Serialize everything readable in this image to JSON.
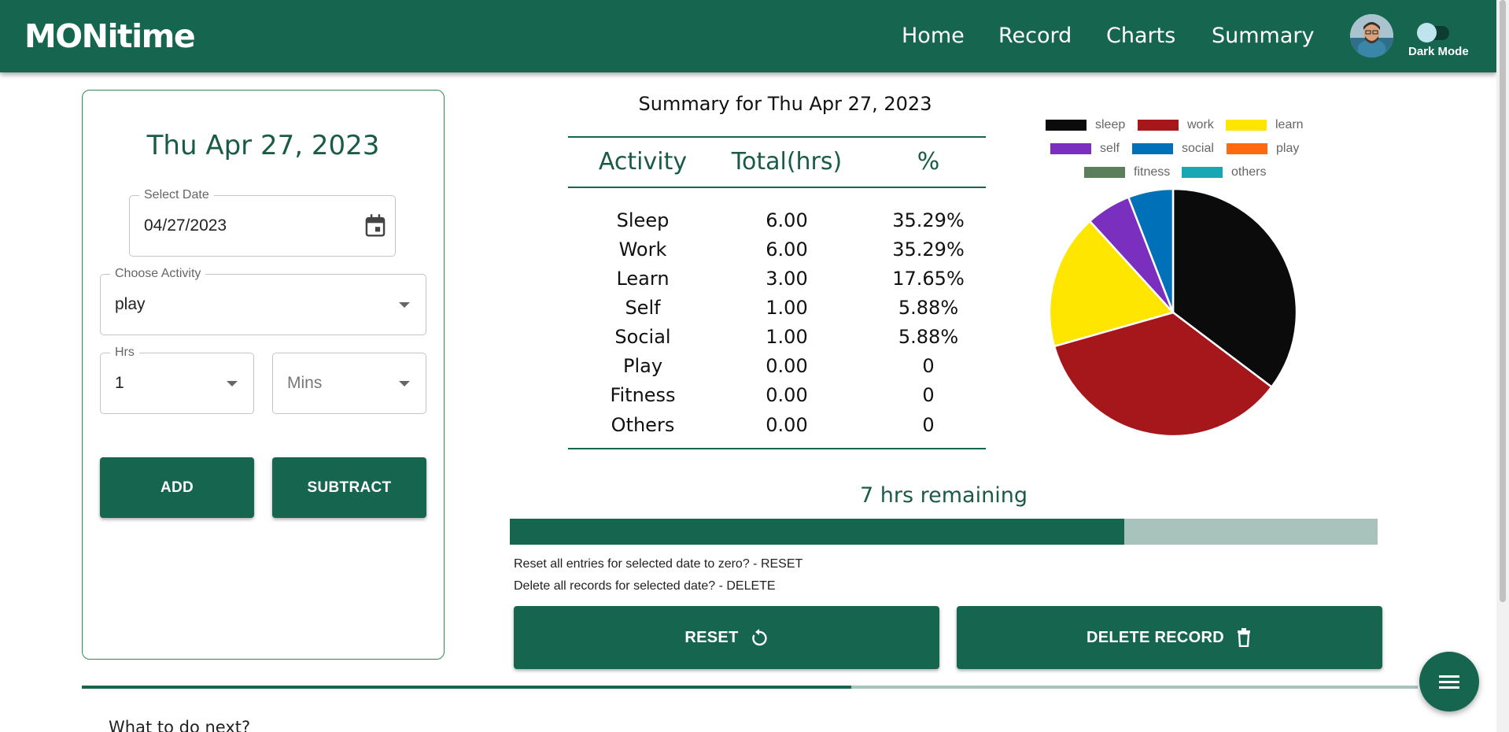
{
  "nav": {
    "brand": "MONitime",
    "links": [
      "Home",
      "Record",
      "Charts",
      "Summary"
    ],
    "dark_mode_label": "Dark Mode"
  },
  "form": {
    "date_heading": "Thu Apr 27, 2023",
    "select_date": {
      "label": "Select Date",
      "value": "04/27/2023"
    },
    "activity": {
      "label": "Choose Activity",
      "value": "play"
    },
    "hrs": {
      "label": "Hrs",
      "value": "1"
    },
    "mins": {
      "placeholder": "Mins"
    },
    "add_label": "ADD",
    "subtract_label": "SUBTRACT"
  },
  "summary": {
    "title": "Summary for Thu Apr 27, 2023",
    "headers": [
      "Activity",
      "Total(hrs)",
      "%"
    ],
    "rows": [
      [
        "Sleep",
        "6.00",
        "35.29%"
      ],
      [
        "Work",
        "6.00",
        "35.29%"
      ],
      [
        "Learn",
        "3.00",
        "17.65%"
      ],
      [
        "Self",
        "1.00",
        "5.88%"
      ],
      [
        "Social",
        "1.00",
        "5.88%"
      ],
      [
        "Play",
        "0.00",
        "0"
      ],
      [
        "Fitness",
        "0.00",
        "0"
      ],
      [
        "Others",
        "0.00",
        "0"
      ]
    ]
  },
  "chart_data": {
    "type": "pie",
    "categories": [
      "sleep",
      "work",
      "learn",
      "self",
      "social",
      "play",
      "fitness",
      "others"
    ],
    "values": [
      6,
      6,
      3,
      1,
      1,
      0,
      0,
      0
    ],
    "colors": [
      "#0b0b0b",
      "#a5171b",
      "#ffe600",
      "#7b2fbe",
      "#0070b8",
      "#ff6a10",
      "#5a7f5a",
      "#1aa7b5"
    ],
    "legend_position": "top"
  },
  "remaining": {
    "text": "7 hrs remaining",
    "fill_fraction": 0.708
  },
  "actions": {
    "reset_hint": "Reset all entries for selected date to zero? - RESET",
    "delete_hint": "Delete all records for selected date? - DELETE",
    "reset_label": "RESET",
    "delete_label": "DELETE RECORD"
  },
  "footer": {
    "progress_fraction": 0.576,
    "next_heading": "What to do next?"
  },
  "colors": {
    "primary": "#16664f",
    "primary_light": "#a8c3bb"
  }
}
